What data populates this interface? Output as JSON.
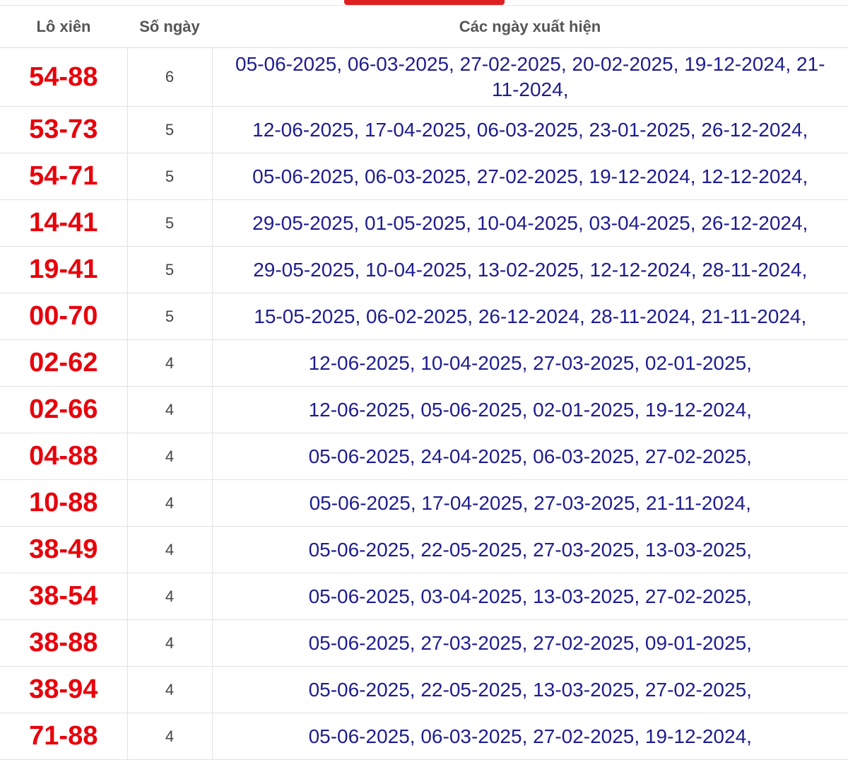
{
  "header": {
    "col_pair": "Lô xiên",
    "col_count": "Số ngày",
    "col_dates": "Các ngày xuất hiện"
  },
  "rows": [
    {
      "pair": "54-88",
      "count": "6",
      "dates": "05-06-2025, 06-03-2025, 27-02-2025, 20-02-2025, 19-12-2024, 21-11-2024,"
    },
    {
      "pair": "53-73",
      "count": "5",
      "dates": "12-06-2025, 17-04-2025, 06-03-2025, 23-01-2025, 26-12-2024,"
    },
    {
      "pair": "54-71",
      "count": "5",
      "dates": "05-06-2025, 06-03-2025, 27-02-2025, 19-12-2024, 12-12-2024,"
    },
    {
      "pair": "14-41",
      "count": "5",
      "dates": "29-05-2025, 01-05-2025, 10-04-2025, 03-04-2025, 26-12-2024,"
    },
    {
      "pair": "19-41",
      "count": "5",
      "dates": "29-05-2025, 10-04-2025, 13-02-2025, 12-12-2024, 28-11-2024,"
    },
    {
      "pair": "00-70",
      "count": "5",
      "dates": "15-05-2025, 06-02-2025, 26-12-2024, 28-11-2024, 21-11-2024,"
    },
    {
      "pair": "02-62",
      "count": "4",
      "dates": "12-06-2025, 10-04-2025, 27-03-2025, 02-01-2025,"
    },
    {
      "pair": "02-66",
      "count": "4",
      "dates": "12-06-2025, 05-06-2025, 02-01-2025, 19-12-2024,"
    },
    {
      "pair": "04-88",
      "count": "4",
      "dates": "05-06-2025, 24-04-2025, 06-03-2025, 27-02-2025,"
    },
    {
      "pair": "10-88",
      "count": "4",
      "dates": "05-06-2025, 17-04-2025, 27-03-2025, 21-11-2024,"
    },
    {
      "pair": "38-49",
      "count": "4",
      "dates": "05-06-2025, 22-05-2025, 27-03-2025, 13-03-2025,"
    },
    {
      "pair": "38-54",
      "count": "4",
      "dates": "05-06-2025, 03-04-2025, 13-03-2025, 27-02-2025,"
    },
    {
      "pair": "38-88",
      "count": "4",
      "dates": "05-06-2025, 27-03-2025, 27-02-2025, 09-01-2025,"
    },
    {
      "pair": "38-94",
      "count": "4",
      "dates": "05-06-2025, 22-05-2025, 13-03-2025, 27-02-2025,"
    },
    {
      "pair": "71-88",
      "count": "4",
      "dates": "05-06-2025, 06-03-2025, 27-02-2025, 19-12-2024,"
    }
  ],
  "colors": {
    "pair_text": "#e8000b",
    "date_text": "#1d1d8e",
    "tab_indicator": "#e02020"
  }
}
